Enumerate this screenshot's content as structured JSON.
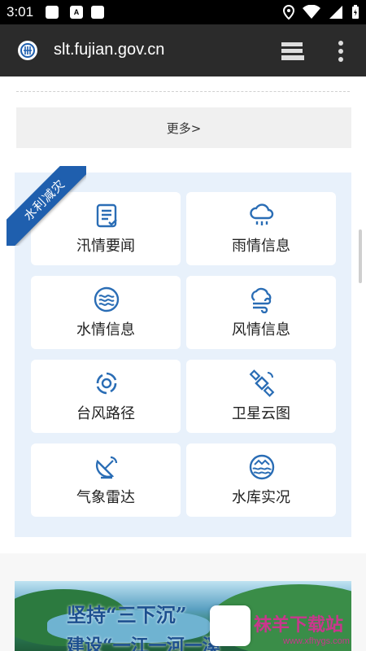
{
  "status_bar": {
    "time": "3:01",
    "icon_a_letter": "A",
    "icons": [
      "notification-icon",
      "a-icon",
      "notification-icon",
      "location-icon",
      "wifi-icon",
      "signal-icon",
      "battery-icon"
    ]
  },
  "browser": {
    "url": "slt.fujian.gov.cn",
    "icons": [
      "site-logo-icon",
      "tabs-icon",
      "more-vert-icon"
    ]
  },
  "more_button": {
    "label": "更多>"
  },
  "section": {
    "ribbon": "水利减灾",
    "tiles": [
      {
        "label": "汛情要闻",
        "icon": "news-list-icon"
      },
      {
        "label": "雨情信息",
        "icon": "rain-cloud-icon"
      },
      {
        "label": "水情信息",
        "icon": "water-waves-icon"
      },
      {
        "label": "风情信息",
        "icon": "wind-cloud-icon"
      },
      {
        "label": "台风路径",
        "icon": "typhoon-icon"
      },
      {
        "label": "卫星云图",
        "icon": "satellite-icon"
      },
      {
        "label": "气象雷达",
        "icon": "radar-dish-icon"
      },
      {
        "label": "水库实况",
        "icon": "reservoir-icon"
      }
    ]
  },
  "banner": {
    "line1": "坚持“三下沉”",
    "line2": "建设“一江一河一溪”"
  },
  "watermark": {
    "text": "袜羊下载站",
    "url": "www.xfhygs.com"
  },
  "colors": {
    "accent": "#1f5fae",
    "icon": "#2a6db5",
    "panel_bg": "#e8f1fb",
    "browser_bar": "#2b2b2b",
    "watermark": "#c9378d"
  }
}
